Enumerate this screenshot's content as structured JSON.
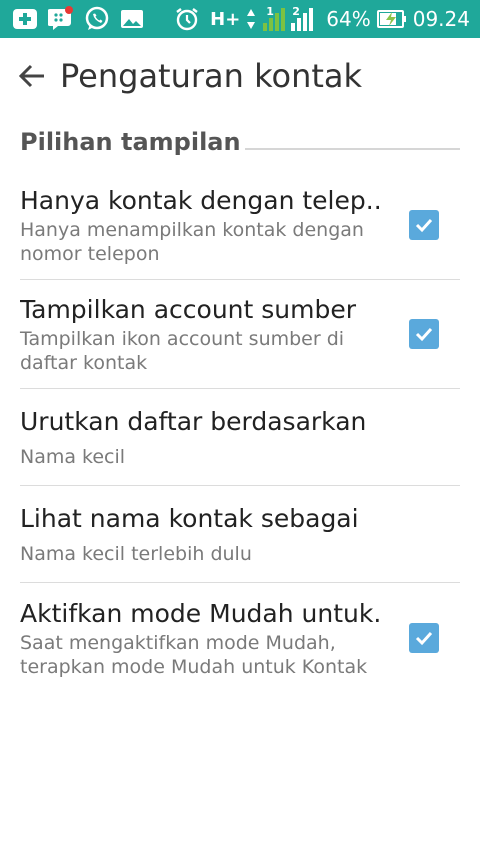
{
  "status_bar": {
    "battery": "64%",
    "time": "09.24",
    "network_type": "H+",
    "sim1_label": "1",
    "sim2_label": "2",
    "icons": [
      "plus-app-icon",
      "bbm-icon",
      "whatsapp-icon",
      "image-icon",
      "alarm-icon",
      "data-arrows-icon",
      "signal-icon",
      "battery-charging-icon"
    ]
  },
  "header": {
    "title": "Pengaturan kontak"
  },
  "section": {
    "title": "Pilihan tampilan"
  },
  "items": [
    {
      "title": "Hanya kontak dengan telep..",
      "summary": "Hanya menampilkan kontak dengan nomor telepon",
      "checked": true
    },
    {
      "title": "Tampilkan account sumber",
      "summary": "Tampilkan ikon account sumber di daftar kontak",
      "checked": true
    },
    {
      "title": "Urutkan daftar berdasarkan",
      "summary": "Nama kecil"
    },
    {
      "title": "Lihat nama kontak sebagai",
      "summary": "Nama kecil terlebih dulu"
    },
    {
      "title": "Aktifkan mode Mudah untuk..",
      "summary": "Saat mengaktifkan mode Mudah, terapkan mode Mudah untuk Kontak",
      "checked": true
    }
  ],
  "colors": {
    "status_bar": "#1fa89a",
    "checkbox": "#5aa9dc",
    "battery_bolt": "#8bc34a",
    "signal": "#7cc242"
  }
}
